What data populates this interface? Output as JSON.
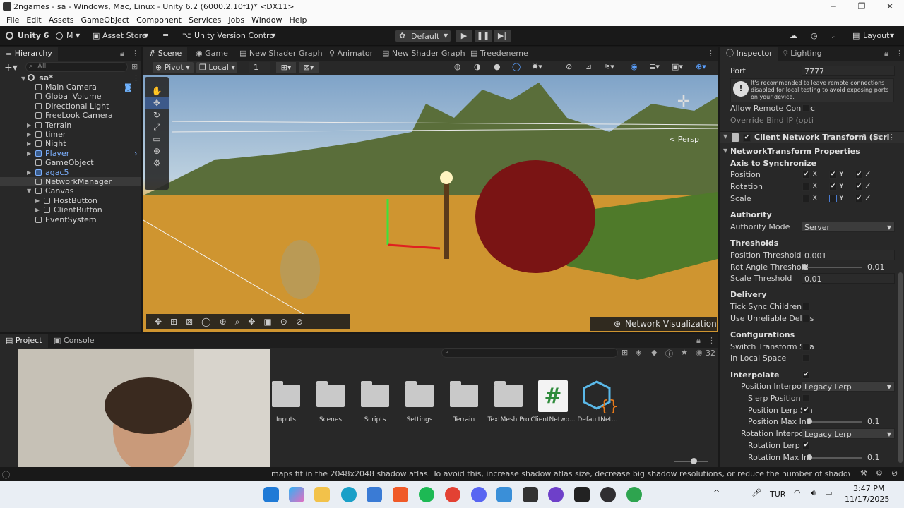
{
  "window": {
    "title": "2ngames - sa - Windows, Mac, Linux - Unity 6.2 (6000.2.10f1)* <DX11>",
    "minimize": "─",
    "maximize": "❐",
    "close": "✕"
  },
  "menu": [
    "File",
    "Edit",
    "Assets",
    "GameObject",
    "Component",
    "Services",
    "Jobs",
    "Window",
    "Help"
  ],
  "toolbar": {
    "unity_version": "Unity 6",
    "account": "M",
    "asset_store": "Asset Store",
    "version_control": "Unity Version Control",
    "layout_default": "Default",
    "layout": "Layout"
  },
  "hierarchy": {
    "tab": "Hierarchy",
    "search_placeholder": "All",
    "scene": "sa*",
    "items": [
      {
        "label": "Main Camera",
        "indent": 1
      },
      {
        "label": "Global Volume",
        "indent": 1
      },
      {
        "label": "Directional Light",
        "indent": 1
      },
      {
        "label": "FreeLook Camera",
        "indent": 1
      },
      {
        "label": "Terrain",
        "indent": 1,
        "arrow": true
      },
      {
        "label": "timer",
        "indent": 1,
        "arrow": true
      },
      {
        "label": "Night",
        "indent": 1,
        "arrow": true
      },
      {
        "label": "Player",
        "indent": 1,
        "arrow": true,
        "prefab": true
      },
      {
        "label": "GameObject",
        "indent": 1
      },
      {
        "label": "agac5",
        "indent": 1,
        "arrow": true,
        "prefab": true
      },
      {
        "label": "NetworkManager",
        "indent": 1,
        "selected": true
      },
      {
        "label": "Canvas",
        "indent": 1,
        "arrow": true,
        "open": true
      },
      {
        "label": "HostButton",
        "indent": 2,
        "arrow": true
      },
      {
        "label": "ClientButton",
        "indent": 2,
        "arrow": true
      },
      {
        "label": "EventSystem",
        "indent": 1
      }
    ]
  },
  "scene_tabs": [
    "Scene",
    "Game",
    "New Shader Graph",
    "Animator",
    "New Shader Graph",
    "Treedeneme"
  ],
  "scene_toolbar": {
    "pivot": "Pivot",
    "local": "Local",
    "grid_snap": "1",
    "persp": "< Persp",
    "network_viz": "Network Visualization"
  },
  "inspector": {
    "tabs": [
      "Inspector",
      "Lighting"
    ],
    "port_label": "Port",
    "port_value": "7777",
    "warning": "It's recommended to leave remote connections disabled for local testing to avoid exposing ports on your device.",
    "allow_remote": "Allow Remote Connec",
    "override_bind": "Override Bind IP (opti",
    "component": "Client Network Transform (Scri",
    "nt_props": "NetworkTransform Properties",
    "axis_sync": "Axis to Synchronize",
    "position": "Position",
    "rotation": "Rotation",
    "scale": "Scale",
    "x": "X",
    "y": "Y",
    "z": "Z",
    "authority": "Authority",
    "authority_mode": "Authority Mode",
    "authority_value": "Server",
    "thresholds": "Thresholds",
    "pos_threshold": "Position Threshold",
    "pos_threshold_val": "0.001",
    "rot_threshold": "Rot Angle Threshold",
    "rot_threshold_val": "0.01",
    "scale_threshold": "Scale Threshold",
    "scale_threshold_val": "0.01",
    "delivery": "Delivery",
    "tick_sync": "Tick Sync Children",
    "unreliable": "Use Unreliable Deltas",
    "configurations": "Configurations",
    "switch_transform": "Switch Transform Spa",
    "local_space": "In Local Space",
    "interpolate": "Interpolate",
    "pos_interp": "Position Interpolati",
    "pos_interp_val": "Legacy Lerp",
    "slerp_pos": "Slerp Position",
    "pos_lerp_smooth": "Position Lerp Sm",
    "pos_max_int": "Position Max Int",
    "pos_max_int_val": "0.1",
    "rot_interp": "Rotation Interpolat",
    "rot_interp_val": "Legacy Lerp",
    "rot_lerp_smooth": "Rotation Lerp Sr",
    "rot_max_int": "Rotation Max Int",
    "rot_max_int_val": "0.1"
  },
  "project": {
    "tabs": [
      "Project",
      "Console"
    ],
    "asset_count": "32",
    "folders": [
      "Inputs",
      "Scenes",
      "Scripts",
      "Settings",
      "Terrain",
      "TextMesh Pro"
    ],
    "script_label": "ClientNetwo...",
    "asset_label": "DefaultNet...",
    "script_glyph": "#"
  },
  "status_message": "maps fit in the 2048x2048 shadow atlas. To avoid this, increase shadow atlas size, decrease big shadow resolutions, or reduce the number of shadow maps active in the",
  "taskbar": {
    "lang": "TUR",
    "time": "3:47 PM",
    "date": "11/17/2025"
  }
}
